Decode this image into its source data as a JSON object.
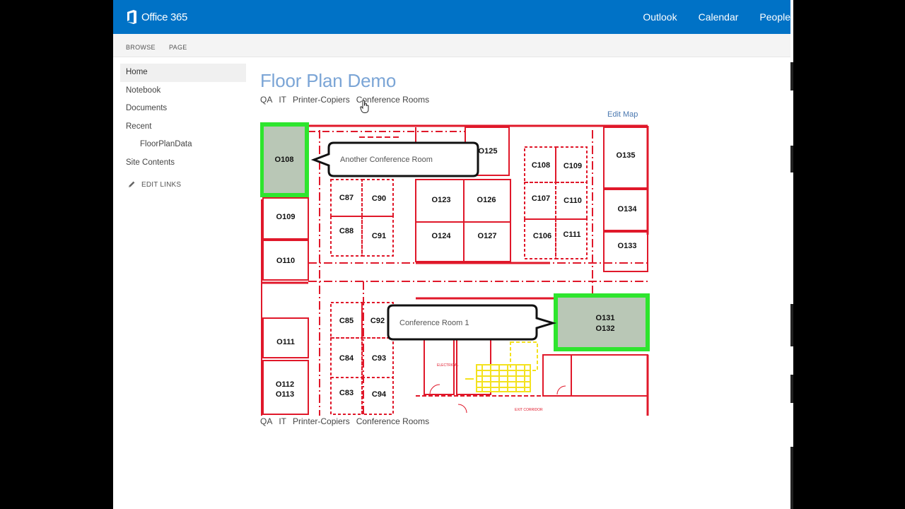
{
  "suite": {
    "brand": "Office 365",
    "nav": [
      "Outlook",
      "Calendar",
      "People"
    ]
  },
  "ribbon": {
    "tabs": [
      "BROWSE",
      "PAGE"
    ]
  },
  "left_nav": {
    "items": [
      {
        "label": "Home",
        "selected": true,
        "sub": false
      },
      {
        "label": "Notebook",
        "selected": false,
        "sub": false
      },
      {
        "label": "Documents",
        "selected": false,
        "sub": false
      },
      {
        "label": "Recent",
        "selected": false,
        "sub": false
      },
      {
        "label": "FloorPlanData",
        "selected": false,
        "sub": true
      },
      {
        "label": "Site Contents",
        "selected": false,
        "sub": false
      }
    ],
    "edit_links": "EDIT LINKS"
  },
  "page": {
    "title": "Floor Plan Demo",
    "filters": [
      "QA",
      "IT",
      "Printer-Copiers",
      "Conference Rooms"
    ],
    "edit_map": "Edit Map"
  },
  "floor_plan": {
    "callouts": {
      "top": "Another Conference Room",
      "bottom": "Conference Room 1"
    },
    "highlighted_rooms": {
      "top": "O108",
      "bottom_line1": "O131",
      "bottom_line2": "O132"
    },
    "rooms": {
      "o125": "O125",
      "o135": "O135",
      "c108": "C108",
      "c109": "C109",
      "c87": "C87",
      "c90": "C90",
      "o123": "O123",
      "o126": "O126",
      "c107": "C107",
      "c110": "C110",
      "o134": "O134",
      "o109": "O109",
      "c88": "C88",
      "c91": "C91",
      "o124": "O124",
      "o127": "O127",
      "c106": "C106",
      "c111": "C111",
      "o133": "O133",
      "o110": "O110",
      "c85": "C85",
      "c92": "C92",
      "o111": "O111",
      "c84": "C84",
      "c93": "C93",
      "o112": "O112",
      "o113": "O113",
      "c83": "C83",
      "c94": "C94"
    },
    "colors": {
      "walls": "#e0182a",
      "highlight_border": "#2ee52e",
      "highlight_fill": "#b9c7b6",
      "stairs": "#f4e21e"
    }
  }
}
